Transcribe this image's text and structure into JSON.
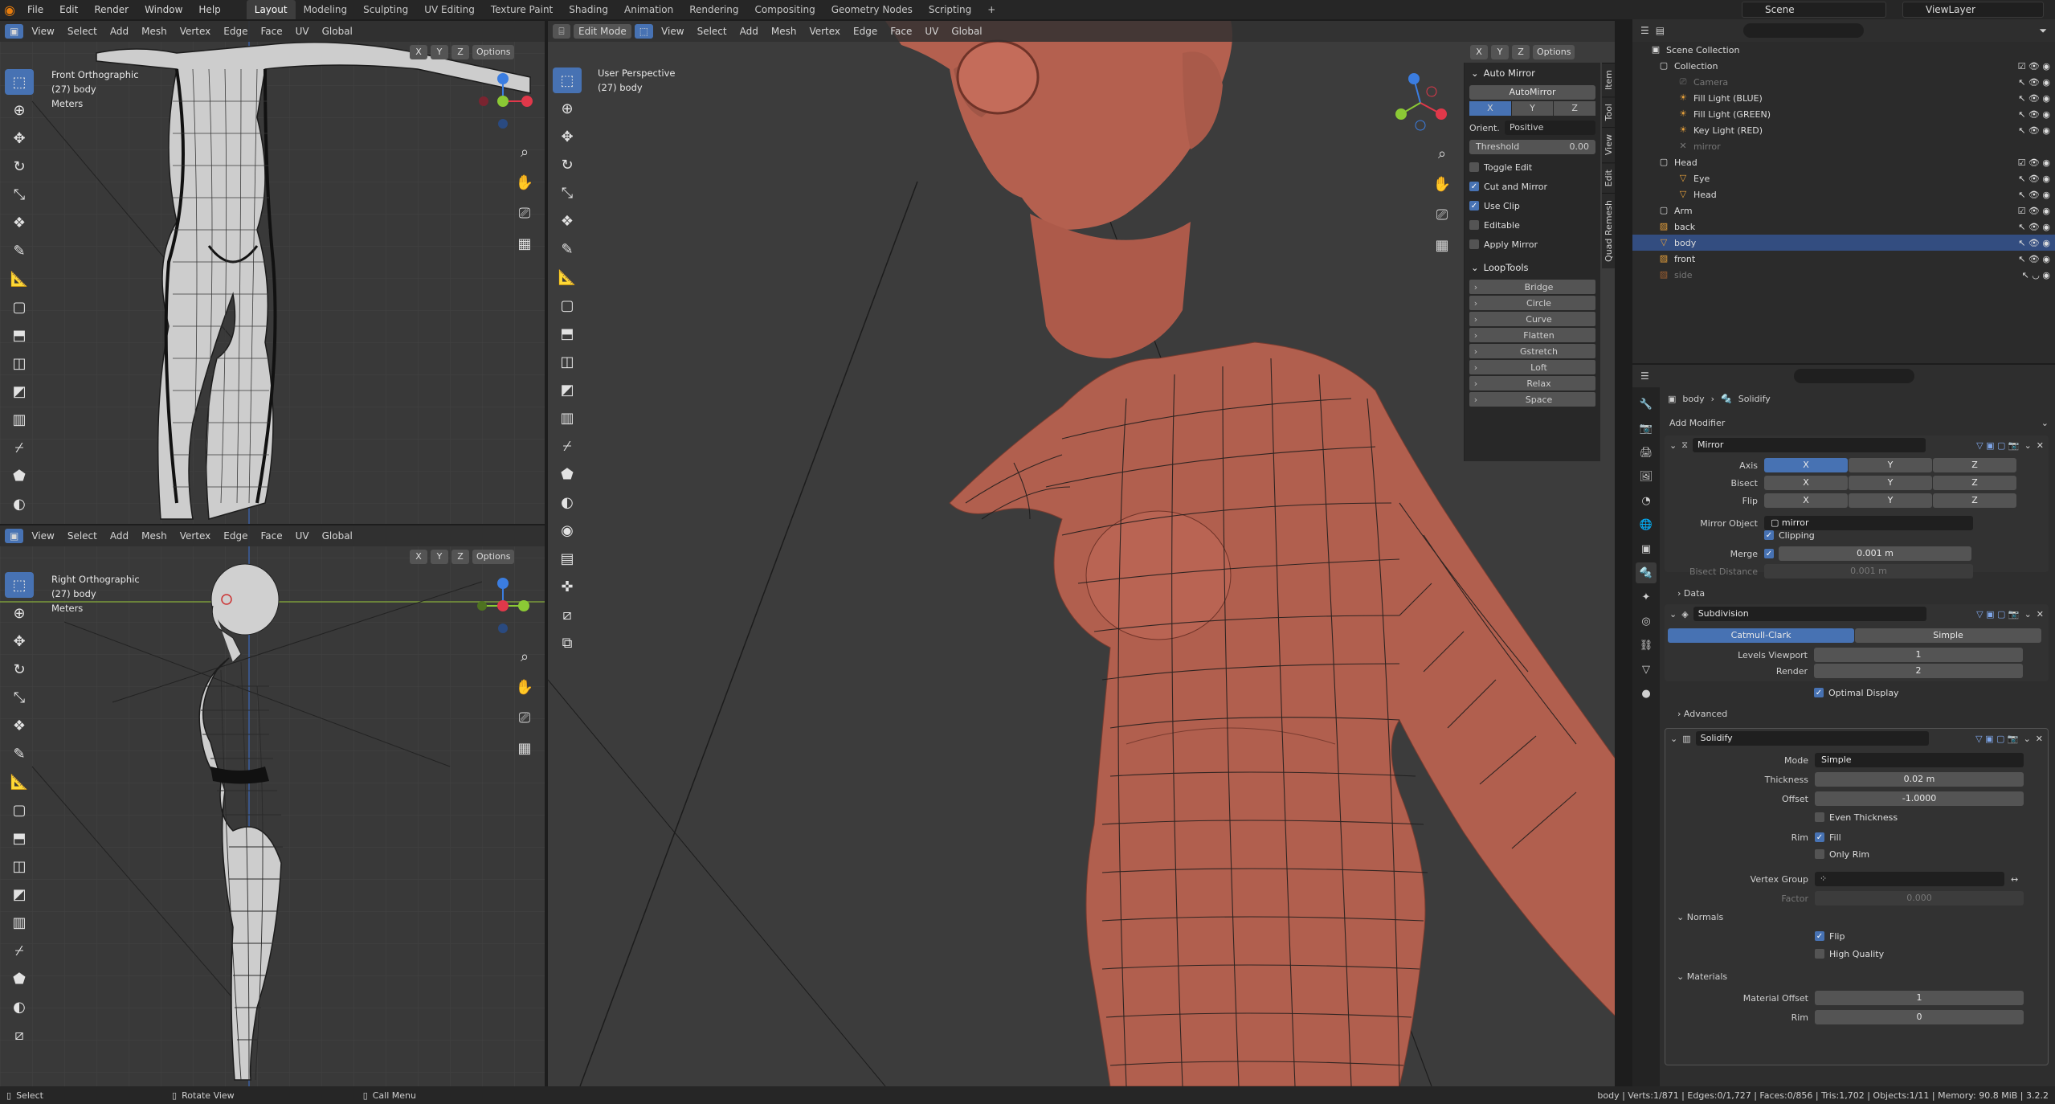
{
  "topbar": {
    "menus": [
      "File",
      "Edit",
      "Render",
      "Window",
      "Help"
    ],
    "workspaces": [
      "Layout",
      "Modeling",
      "Sculpting",
      "UV Editing",
      "Texture Paint",
      "Shading",
      "Animation",
      "Rendering",
      "Compositing",
      "Geometry Nodes",
      "Scripting"
    ],
    "active_workspace": "Layout",
    "add_tab": "+",
    "scene": "Scene",
    "view_layer": "ViewLayer"
  },
  "vp_front": {
    "menus": [
      "View",
      "Select",
      "Add",
      "Mesh",
      "Vertex",
      "Edge",
      "Face",
      "UV"
    ],
    "transform": "Global",
    "axes": [
      "X",
      "Y",
      "Z"
    ],
    "options": "Options",
    "title": "Front Orthographic",
    "object": "(27) body",
    "units": "Meters"
  },
  "vp_right": {
    "menus": [
      "View",
      "Select",
      "Add",
      "Mesh",
      "Vertex",
      "Edge",
      "Face",
      "UV"
    ],
    "transform": "Global",
    "axes": [
      "X",
      "Y",
      "Z"
    ],
    "options": "Options",
    "title": "Right Orthographic",
    "object": "(27) body",
    "units": "Meters"
  },
  "vp_main": {
    "mode": "Edit Mode",
    "menus": [
      "View",
      "Select",
      "Add",
      "Mesh",
      "Vertex",
      "Edge",
      "Face",
      "UV"
    ],
    "transform": "Global",
    "axes": [
      "X",
      "Y",
      "Z"
    ],
    "options": "Options",
    "title": "User Perspective",
    "object": "(27) body"
  },
  "auto_mirror": {
    "header": "Auto Mirror",
    "button": "AutoMirror",
    "axes": [
      "X",
      "Y",
      "Z"
    ],
    "orient_label": "Orient.",
    "orient_value": "Positive",
    "threshold_label": "Threshold",
    "threshold_value": "0.00",
    "checks": [
      {
        "label": "Toggle Edit",
        "on": false
      },
      {
        "label": "Cut and Mirror",
        "on": true
      },
      {
        "label": "Use Clip",
        "on": true
      },
      {
        "label": "Editable",
        "on": false
      },
      {
        "label": "Apply Mirror",
        "on": false
      }
    ]
  },
  "looptools": {
    "header": "LoopTools",
    "items": [
      "Bridge",
      "Circle",
      "Curve",
      "Flatten",
      "Gstretch",
      "Loft",
      "Relax",
      "Space"
    ]
  },
  "n_tabs": [
    "Item",
    "Tool",
    "View",
    "Edit",
    "Quad Remesh"
  ],
  "outliner": {
    "rows": [
      {
        "label": "Scene Collection",
        "indent": 0
      },
      {
        "label": "Collection",
        "indent": 1
      },
      {
        "label": "Camera",
        "indent": 2,
        "dim": true
      },
      {
        "label": "Fill Light (BLUE)",
        "indent": 2
      },
      {
        "label": "Fill Light (GREEN)",
        "indent": 2
      },
      {
        "label": "Key Light (RED)",
        "indent": 2
      },
      {
        "label": "mirror",
        "indent": 2,
        "dim": true
      },
      {
        "label": "Head",
        "indent": 1
      },
      {
        "label": "Eye",
        "indent": 2
      },
      {
        "label": "Head",
        "indent": 2
      },
      {
        "label": "Arm",
        "indent": 1
      },
      {
        "label": "back",
        "indent": 1
      },
      {
        "label": "body",
        "indent": 1,
        "selected": true
      },
      {
        "label": "front",
        "indent": 1
      },
      {
        "label": "side",
        "indent": 1,
        "dim": true
      }
    ]
  },
  "properties": {
    "breadcrumb_object": "body",
    "breadcrumb_modifier": "Solidify",
    "add_modifier": "Add Modifier",
    "mirror": {
      "name": "Mirror",
      "axis_label": "Axis",
      "bisect_label": "Bisect",
      "flip_label": "Flip",
      "xyz": [
        "X",
        "Y",
        "Z"
      ],
      "mirror_object_label": "Mirror Object",
      "mirror_object_value": "mirror",
      "clipping_label": "Clipping",
      "merge_label": "Merge",
      "merge_value": "0.001 m",
      "bisect_distance_label": "Bisect Distance",
      "bisect_distance_value": "0.001 m",
      "data_label": "Data"
    },
    "subdivision": {
      "name": "Subdivision",
      "tab_catmull": "Catmull-Clark",
      "tab_simple": "Simple",
      "levels_viewport_label": "Levels Viewport",
      "levels_viewport_value": "1",
      "render_label": "Render",
      "render_value": "2",
      "optimal_display_label": "Optimal Display",
      "advanced_label": "Advanced"
    },
    "solidify": {
      "name": "Solidify",
      "mode_label": "Mode",
      "mode_value": "Simple",
      "thickness_label": "Thickness",
      "thickness_value": "0.02 m",
      "offset_label": "Offset",
      "offset_value": "-1.0000",
      "even_thickness_label": "Even Thickness",
      "rim_label": "Rim",
      "fill_label": "Fill",
      "only_rim_label": "Only Rim",
      "vertex_group_label": "Vertex Group",
      "factor_label": "Factor",
      "factor_value": "0.000",
      "normals_label": "Normals",
      "flip_label": "Flip",
      "high_quality_label": "High Quality",
      "materials_label": "Materials",
      "material_offset_label": "Material Offset",
      "material_offset_value": "1",
      "rim_mat_label": "Rim",
      "rim_mat_value": "0"
    }
  },
  "statusbar": {
    "select": "Select",
    "rotate": "Rotate View",
    "call_menu": "Call Menu",
    "stats": "body | Verts:1/871 | Edges:0/1,727 | Faces:0/856 | Tris:1,702 | Objects:1/11 | Memory: 90.8 MiB | 3.2.2"
  },
  "colors": {
    "accent": "#4772b3",
    "skin": "#b4604f",
    "clay": "#c9c9c9",
    "x_axis": "#e0384a",
    "y_axis": "#8bc935",
    "z_axis": "#3b7de0"
  }
}
